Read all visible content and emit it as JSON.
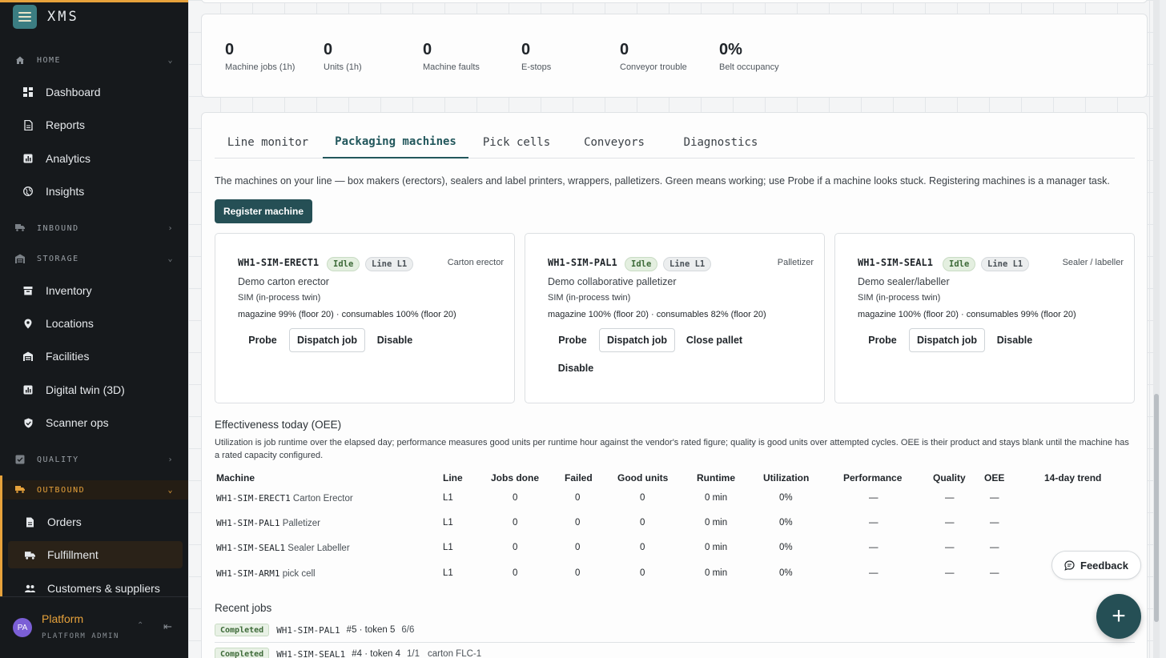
{
  "app": {
    "name": "XMS"
  },
  "sidebar": {
    "sections": {
      "home": {
        "label": "HOME",
        "items": [
          "Dashboard",
          "Reports",
          "Analytics",
          "Insights"
        ]
      },
      "inbound": {
        "label": "INBOUND"
      },
      "storage": {
        "label": "STORAGE",
        "items": [
          "Inventory",
          "Locations",
          "Facilities",
          "Digital twin (3D)",
          "Scanner ops"
        ]
      },
      "quality": {
        "label": "QUALITY"
      },
      "outbound": {
        "label": "OUTBOUND",
        "items": [
          "Orders",
          "Fulfillment",
          "Customers & suppliers"
        ],
        "selected": "Fulfillment"
      }
    },
    "user": {
      "initials": "PA",
      "name": "Platform",
      "role": "PLATFORM ADMIN"
    }
  },
  "stats": [
    {
      "value": "0",
      "label": "Machine jobs (1h)"
    },
    {
      "value": "0",
      "label": "Units (1h)"
    },
    {
      "value": "0",
      "label": "Machine faults"
    },
    {
      "value": "0",
      "label": "E-stops"
    },
    {
      "value": "0",
      "label": "Conveyor trouble"
    },
    {
      "value": "0%",
      "label": "Belt occupancy"
    }
  ],
  "tabs": [
    "Line monitor",
    "Packaging machines",
    "Pick cells",
    "Conveyors",
    "Diagnostics"
  ],
  "active_tab": "Packaging machines",
  "intro": "The machines on your line — box makers (erectors), sealers and label printers, wrappers, palletizers. Green means working; use Probe if a machine looks stuck. Registering machines is a manager task.",
  "register_button": "Register machine",
  "machines": [
    {
      "id": "WH1-SIM-ERECT1",
      "status": "Idle",
      "line": "Line L1",
      "type": "Carton erector",
      "desc": "Demo carton erector",
      "sim": "SIM (in-process twin)",
      "supplies": "magazine 99% (floor 20) · consumables 100% (floor 20)",
      "actions": [
        "Probe",
        "Dispatch job",
        "Disable"
      ]
    },
    {
      "id": "WH1-SIM-PAL1",
      "status": "Idle",
      "line": "Line L1",
      "type": "Palletizer",
      "desc": "Demo collaborative palletizer",
      "sim": "SIM (in-process twin)",
      "supplies": "magazine 100% (floor 20) · consumables 82% (floor 20)",
      "actions": [
        "Probe",
        "Dispatch job",
        "Close pallet",
        "Disable"
      ]
    },
    {
      "id": "WH1-SIM-SEAL1",
      "status": "Idle",
      "line": "Line L1",
      "type": "Sealer / labeller",
      "desc": "Demo sealer/labeller",
      "sim": "SIM (in-process twin)",
      "supplies": "magazine 100% (floor 20) · consumables 99% (floor 20)",
      "actions": [
        "Probe",
        "Dispatch job",
        "Disable"
      ]
    }
  ],
  "oee": {
    "title": "Effectiveness today (OEE)",
    "description": "Utilization is job runtime over the elapsed day; performance measures good units per runtime hour against the vendor's rated figure; quality is good units over attempted cycles. OEE is their product and stays blank until the machine has a rated capacity configured.",
    "columns": [
      "Machine",
      "Line",
      "Jobs done",
      "Failed",
      "Good units",
      "Runtime",
      "Utilization",
      "Performance",
      "Quality",
      "OEE",
      "14-day trend"
    ],
    "rows": [
      {
        "id": "WH1-SIM-ERECT1",
        "name": "Carton Erector",
        "line": "L1",
        "jobs": "0",
        "failed": "0",
        "good": "0",
        "runtime": "0 min",
        "util": "0%",
        "perf": "—",
        "quality": "—",
        "oee": "—"
      },
      {
        "id": "WH1-SIM-PAL1",
        "name": "Palletizer",
        "line": "L1",
        "jobs": "0",
        "failed": "0",
        "good": "0",
        "runtime": "0 min",
        "util": "0%",
        "perf": "—",
        "quality": "—",
        "oee": "—"
      },
      {
        "id": "WH1-SIM-SEAL1",
        "name": "Sealer Labeller",
        "line": "L1",
        "jobs": "0",
        "failed": "0",
        "good": "0",
        "runtime": "0 min",
        "util": "0%",
        "perf": "—",
        "quality": "—",
        "oee": "—"
      },
      {
        "id": "WH1-SIM-ARM1",
        "name": "pick cell",
        "line": "L1",
        "jobs": "0",
        "failed": "0",
        "good": "0",
        "runtime": "0 min",
        "util": "0%",
        "perf": "—",
        "quality": "—",
        "oee": "—"
      }
    ]
  },
  "recent_jobs": {
    "title": "Recent jobs",
    "items": [
      {
        "status": "Completed",
        "machine": "WH1-SIM-PAL1",
        "text": "#5 · token 5",
        "count": "6/6",
        "extra": ""
      },
      {
        "status": "Completed",
        "machine": "WH1-SIM-SEAL1",
        "text": "#4 · token 4",
        "count": "1/1",
        "extra": "carton FLC-1"
      }
    ]
  },
  "feedback_label": "Feedback",
  "fab_label": "+"
}
